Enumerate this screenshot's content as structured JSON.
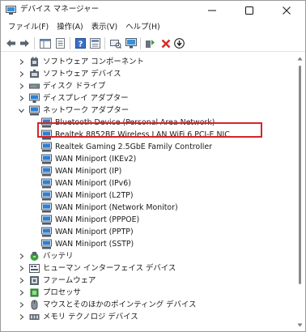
{
  "window": {
    "title": "デバイス マネージャー",
    "controls": {
      "minimize": "minimize",
      "maximize": "maximize",
      "close": "close"
    }
  },
  "menu": [
    "ファイル(F)",
    "操作(A)",
    "表示(V)",
    "ヘルプ(H)"
  ],
  "toolbar": [
    "back-icon",
    "forward-icon",
    "show-hide-console-tree-icon",
    "properties-icon",
    "help-icon",
    "properties-sheet-icon",
    "scan-hardware-icon",
    "monitor-icon",
    "update-driver-icon",
    "uninstall-icon",
    "download-icon"
  ],
  "tree": {
    "items": [
      {
        "label": "ソフトウェア コンポーネント",
        "expanded": false,
        "icon": "software-component-icon"
      },
      {
        "label": "ソフトウェア デバイス",
        "expanded": false,
        "icon": "software-device-icon"
      },
      {
        "label": "ディスク ドライブ",
        "expanded": false,
        "icon": "disk-drive-icon"
      },
      {
        "label": "ディスプレイ アダプター",
        "expanded": false,
        "icon": "display-adapter-icon"
      },
      {
        "label": "ネットワーク アダプター",
        "expanded": true,
        "icon": "network-adapter-icon",
        "children": [
          {
            "label": "Bluetooth Device (Personal Area Network)",
            "icon": "network-adapter-icon"
          },
          {
            "label": "Realtek 8852BE Wireless LAN WiFi 6 PCI-E NIC",
            "icon": "network-adapter-icon",
            "highlighted": true
          },
          {
            "label": "Realtek Gaming 2.5GbE Family Controller",
            "icon": "network-adapter-icon"
          },
          {
            "label": "WAN Miniport (IKEv2)",
            "icon": "network-adapter-icon"
          },
          {
            "label": "WAN Miniport (IP)",
            "icon": "network-adapter-icon"
          },
          {
            "label": "WAN Miniport (IPv6)",
            "icon": "network-adapter-icon"
          },
          {
            "label": "WAN Miniport (L2TP)",
            "icon": "network-adapter-icon"
          },
          {
            "label": "WAN Miniport (Network Monitor)",
            "icon": "network-adapter-icon"
          },
          {
            "label": "WAN Miniport (PPPOE)",
            "icon": "network-adapter-icon"
          },
          {
            "label": "WAN Miniport (PPTP)",
            "icon": "network-adapter-icon"
          },
          {
            "label": "WAN Miniport (SSTP)",
            "icon": "network-adapter-icon"
          }
        ]
      },
      {
        "label": "バッテリ",
        "expanded": false,
        "icon": "battery-icon"
      },
      {
        "label": "ヒューマン インターフェイス デバイス",
        "expanded": false,
        "icon": "hid-icon"
      },
      {
        "label": "ファームウェア",
        "expanded": false,
        "icon": "firmware-icon"
      },
      {
        "label": "プロセッサ",
        "expanded": false,
        "icon": "processor-icon"
      },
      {
        "label": "マウスとそのほかのポインティング デバイス",
        "expanded": false,
        "icon": "mouse-icon"
      },
      {
        "label": "メモリ テクノロジ デバイス",
        "expanded": false,
        "icon": "memory-tech-icon"
      }
    ]
  },
  "colors": {
    "highlight_border": "#d8232a",
    "icon_blue": "#2d7fd3",
    "icon_green": "#3aa13a"
  }
}
